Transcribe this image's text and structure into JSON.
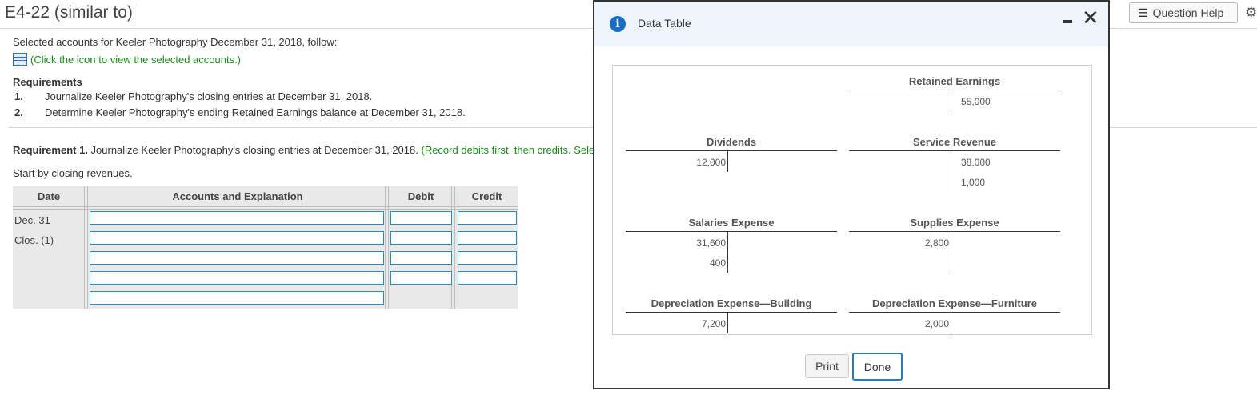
{
  "header": {
    "title": "E4-22 (similar to)",
    "question_help": "Question Help"
  },
  "intro": {
    "selected_text": "Selected accounts for Keeler Photography December 31, 2018, follow:",
    "icon_link": "(Click the icon to view the selected accounts.)"
  },
  "requirements": {
    "heading": "Requirements",
    "items": [
      {
        "num": "1.",
        "text": "Journalize Keeler Photography's closing entries at December 31, 2018."
      },
      {
        "num": "2.",
        "text": "Determine Keeler Photography's ending Retained Earnings balance at December 31, 2018."
      }
    ]
  },
  "requirement1": {
    "label": "Requirement 1.",
    "text": " Journalize Keeler Photography's closing entries at December 31, 2018.",
    "note": " (Record debits first, then credits. Sele",
    "start": "Start by closing revenues."
  },
  "journal": {
    "headers": {
      "date": "Date",
      "accounts": "Accounts and Explanation",
      "debit": "Debit",
      "credit": "Credit"
    },
    "date_lines": [
      "Dec. 31",
      "Clos. (1)"
    ],
    "inputs": [
      {
        "account": "",
        "debit": "",
        "credit": ""
      },
      {
        "account": "",
        "debit": "",
        "credit": ""
      },
      {
        "account": "",
        "debit": "",
        "credit": ""
      },
      {
        "account": "",
        "debit": "",
        "credit": ""
      },
      {
        "account": ""
      }
    ]
  },
  "modal": {
    "title": "Data Table",
    "info_icon": "i",
    "close_icon": "✕",
    "accounts": [
      {
        "name": "Retained Earnings",
        "debits": [],
        "credits": [
          "55,000"
        ]
      },
      {
        "name": "Dividends",
        "debits": [
          "12,000"
        ],
        "credits": []
      },
      {
        "name": "Service Revenue",
        "debits": [],
        "credits": [
          "38,000",
          "1,000"
        ]
      },
      {
        "name": "Salaries Expense",
        "debits": [
          "31,600",
          "400"
        ],
        "credits": []
      },
      {
        "name": "Supplies Expense",
        "debits": [
          "2,800"
        ],
        "credits": []
      },
      {
        "name": "Depreciation Expense—Building",
        "debits": [
          "7,200"
        ],
        "credits": []
      },
      {
        "name": "Depreciation Expense—Furniture",
        "debits": [
          "2,000"
        ],
        "credits": []
      }
    ],
    "print_label": "Print",
    "done_label": "Done"
  }
}
